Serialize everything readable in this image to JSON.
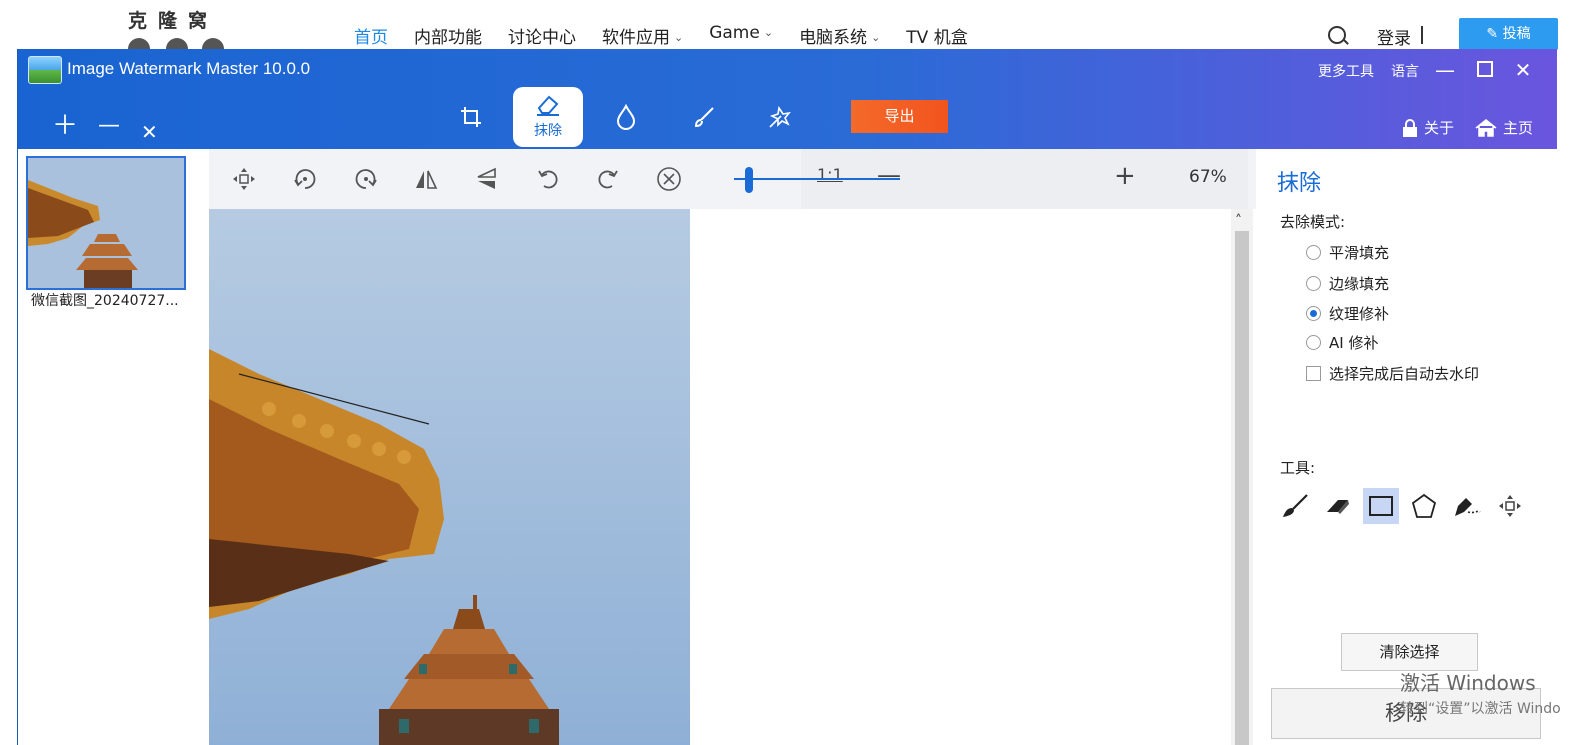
{
  "site": {
    "logo_text": "克隆窝",
    "nav": [
      {
        "label": "首页",
        "active": true,
        "dropdown": false
      },
      {
        "label": "内部功能",
        "active": false,
        "dropdown": false
      },
      {
        "label": "讨论中心",
        "active": false,
        "dropdown": false
      },
      {
        "label": "软件应用",
        "active": false,
        "dropdown": true
      },
      {
        "label": "Game",
        "active": false,
        "dropdown": true
      },
      {
        "label": "电脑系统",
        "active": false,
        "dropdown": true
      },
      {
        "label": "TV 机盒",
        "active": false,
        "dropdown": false
      }
    ],
    "login_label": "登录",
    "post_label": "投稿",
    "post_color": "#2d9bf0",
    "active_color": "#1e88e5"
  },
  "app": {
    "title": "Image Watermark Master 10.0.0",
    "more_tools": "更多工具",
    "language": "语言",
    "tabs": [
      {
        "name": "crop",
        "label": "",
        "active": false
      },
      {
        "name": "erase",
        "label": "抹除",
        "active": true
      },
      {
        "name": "watermark",
        "label": "",
        "active": false
      },
      {
        "name": "brush",
        "label": "",
        "active": false
      },
      {
        "name": "magic",
        "label": "",
        "active": false
      }
    ],
    "export_label": "导出",
    "export_color": "#f2541e",
    "about_label": "关于",
    "home_label": "主页",
    "theme_color": "#1a6bd6"
  },
  "files": [
    {
      "name": "微信截图_20240727..."
    }
  ],
  "canvas_toolbar": {
    "ratio_label": "1:1",
    "zoom": "67%",
    "zoom_fraction": 0.09,
    "icons": [
      "move-icon",
      "rotate-left-icon",
      "rotate-right-icon",
      "flip-horizontal-icon",
      "flip-vertical-icon",
      "undo-icon",
      "redo-icon",
      "cancel-icon"
    ]
  },
  "erase_panel": {
    "title": "抹除",
    "mode_label": "去除模式:",
    "modes": [
      {
        "label": "平滑填充",
        "selected": false
      },
      {
        "label": "边缘填充",
        "selected": false
      },
      {
        "label": "纹理修补",
        "selected": true
      },
      {
        "label": "AI 修补",
        "selected": false
      }
    ],
    "auto_remove_label": "选择完成后自动去水印",
    "auto_remove_checked": false,
    "tools_label": "工具:",
    "tools": [
      {
        "name": "brush-tool-icon",
        "selected": false
      },
      {
        "name": "eraser-tool-icon",
        "selected": false
      },
      {
        "name": "rectangle-tool-icon",
        "selected": true
      },
      {
        "name": "polygon-tool-icon",
        "selected": false
      },
      {
        "name": "lasso-pen-tool-icon",
        "selected": false
      },
      {
        "name": "move-tool-icon",
        "selected": false
      }
    ],
    "clear_label": "清除选择",
    "remove_label": "移除"
  },
  "windows_activation": {
    "line1": "激活 Windows",
    "line2": "转到“设置”以激活 Windo"
  }
}
